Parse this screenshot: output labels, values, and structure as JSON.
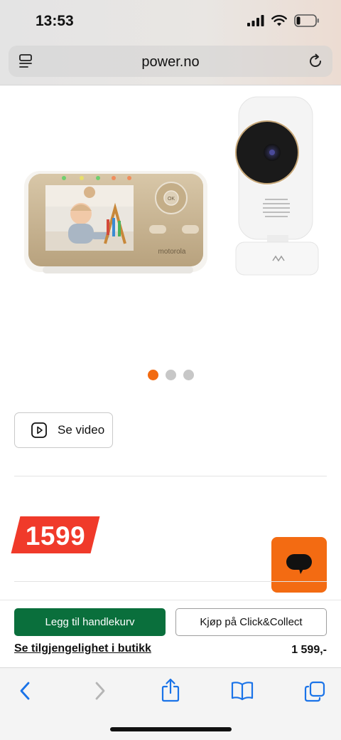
{
  "status_bar": {
    "time": "13:53",
    "battery_level": 0.2
  },
  "browser": {
    "url": "power.no"
  },
  "product": {
    "image_alt": "Motorola baby monitor with parent unit and camera",
    "brand_on_device": "motorola",
    "carousel": {
      "total": 3,
      "active_index": 0
    },
    "video_button_label": "Se video",
    "price_tag": "1599"
  },
  "cart_bar": {
    "add_to_cart_label": "Legg til handlekurv",
    "click_collect_label": "Kjøp på Click&Collect",
    "availability_link": "Se tilgjengelighet i butikk",
    "total_price": "1 599,-"
  },
  "colors": {
    "accent_orange": "#f36b12",
    "price_red": "#f03a2a",
    "cart_green": "#0a6f3c",
    "ios_blue": "#1a73e8"
  },
  "icons": {
    "signal": "cellular-signal-icon",
    "wifi": "wifi-icon",
    "battery": "battery-icon",
    "reader": "reader-mode-icon",
    "reload": "reload-icon",
    "play": "play-icon",
    "chat": "chat-icon",
    "back": "back-arrow-icon",
    "forward": "forward-arrow-icon",
    "share": "share-icon",
    "bookmarks": "bookmarks-icon",
    "tabs": "tabs-icon"
  }
}
